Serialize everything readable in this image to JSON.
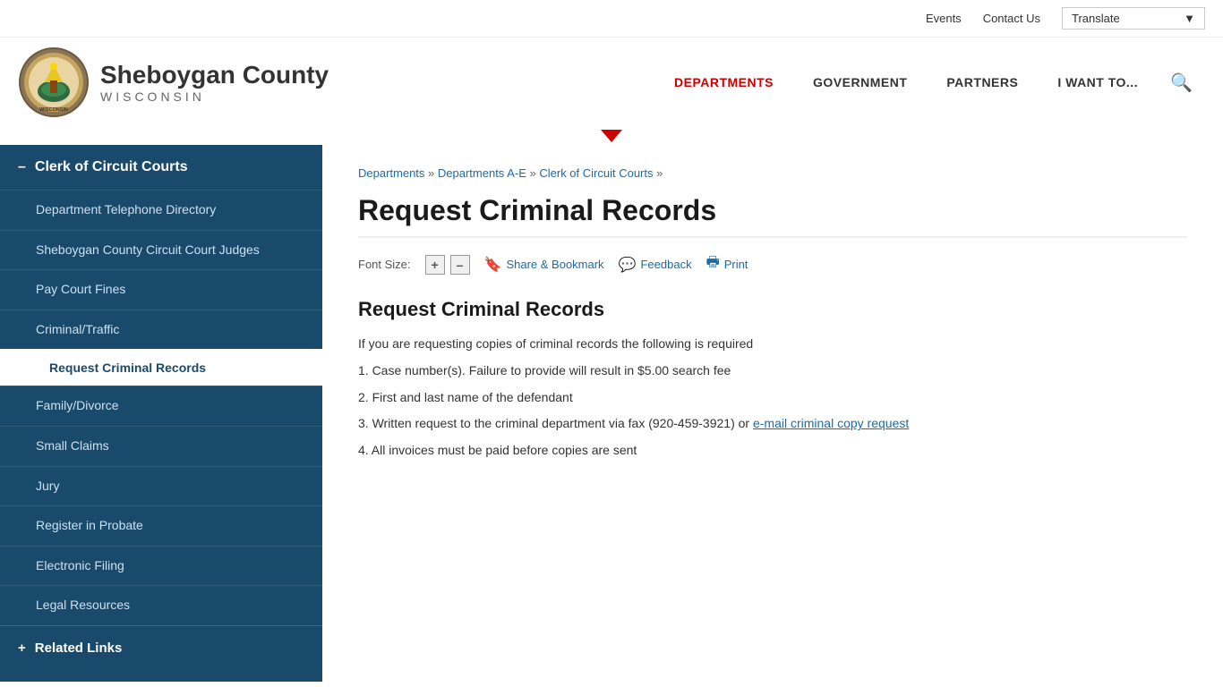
{
  "topbar": {
    "events_label": "Events",
    "contact_label": "Contact Us",
    "translate_label": "Translate"
  },
  "header": {
    "county_name": "Sheboygan County",
    "state_name": "WISCONSIN",
    "logo_alt": "Sheboygan County Wisconsin",
    "nav": [
      {
        "label": "DEPARTMENTS",
        "active": true
      },
      {
        "label": "GOVERNMENT",
        "active": false
      },
      {
        "label": "PARTNERS",
        "active": false
      },
      {
        "label": "I WANT TO...",
        "active": false
      }
    ]
  },
  "sidebar": {
    "section_title": "Clerk of Circuit Courts",
    "minus_symbol": "–",
    "items": [
      {
        "label": "Department Telephone Directory",
        "active": false,
        "indent": true
      },
      {
        "label": "Sheboygan County Circuit Court Judges",
        "active": false,
        "indent": true
      },
      {
        "label": "Pay Court Fines",
        "active": false,
        "indent": true
      },
      {
        "label": "Criminal/Traffic",
        "active": false,
        "indent": true
      },
      {
        "label": "Request Criminal Records",
        "active": true,
        "indent": false
      },
      {
        "label": "Family/Divorce",
        "active": false,
        "indent": true
      },
      {
        "label": "Small Claims",
        "active": false,
        "indent": true
      },
      {
        "label": "Jury",
        "active": false,
        "indent": true
      },
      {
        "label": "Register in Probate",
        "active": false,
        "indent": true
      },
      {
        "label": "Electronic Filing",
        "active": false,
        "indent": true
      },
      {
        "label": "Legal Resources",
        "active": false,
        "indent": true
      }
    ],
    "related_links_label": "Related Links",
    "plus_symbol": "+"
  },
  "breadcrumb": {
    "items": [
      {
        "label": "Departments",
        "link": true
      },
      {
        "label": "Departments A-E",
        "link": true
      },
      {
        "label": "Clerk of Circuit Courts",
        "link": true
      }
    ],
    "separator": "»"
  },
  "main": {
    "page_title": "Request Criminal Records",
    "font_size_label": "Font Size:",
    "font_plus": "+",
    "font_minus": "–",
    "share_bookmark_label": "Share & Bookmark",
    "feedback_label": "Feedback",
    "print_label": "Print",
    "content_heading": "Request Criminal Records",
    "content_intro": "If you are requesting copies of criminal records the following is required",
    "content_item1": "1. Case number(s). Failure to provide will result in $5.00 search fee",
    "content_item2": "2. First and last name of the defendant",
    "content_item3": "3. Written request to the criminal department via fax (920-459-3921) or ",
    "content_item3_link": "e-mail criminal copy request",
    "content_item4": "4. All invoices must be paid before copies are sent"
  }
}
